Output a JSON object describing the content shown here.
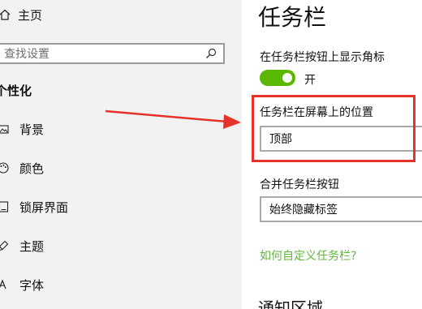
{
  "sidebar": {
    "home_label": "主页",
    "search_placeholder": "查找设置",
    "section_title": "个性化",
    "items": [
      {
        "label": "背景",
        "icon": "image-icon"
      },
      {
        "label": "颜色",
        "icon": "palette-icon"
      },
      {
        "label": "锁屏界面",
        "icon": "lock-screen-icon"
      },
      {
        "label": "主题",
        "icon": "brush-icon"
      },
      {
        "label": "字体",
        "icon": "font-icon"
      }
    ]
  },
  "main": {
    "title": "任务栏",
    "badge_setting_label": "在任务栏按钮上显示角标",
    "badge_toggle_state": "开",
    "badge_toggle_on": true,
    "position_label": "任务栏在屏幕上的位置",
    "position_value": "顶部",
    "combine_label": "合并任务栏按钮",
    "combine_value": "始终隐藏标签",
    "customize_link": "如何自定义任务栏?",
    "notification_title": "通知区域"
  },
  "colors": {
    "accent_green": "#5bb800",
    "link_green": "#5fb83b",
    "annotation_red": "#e5332a",
    "sidebar_bg": "#f2f2f2"
  }
}
